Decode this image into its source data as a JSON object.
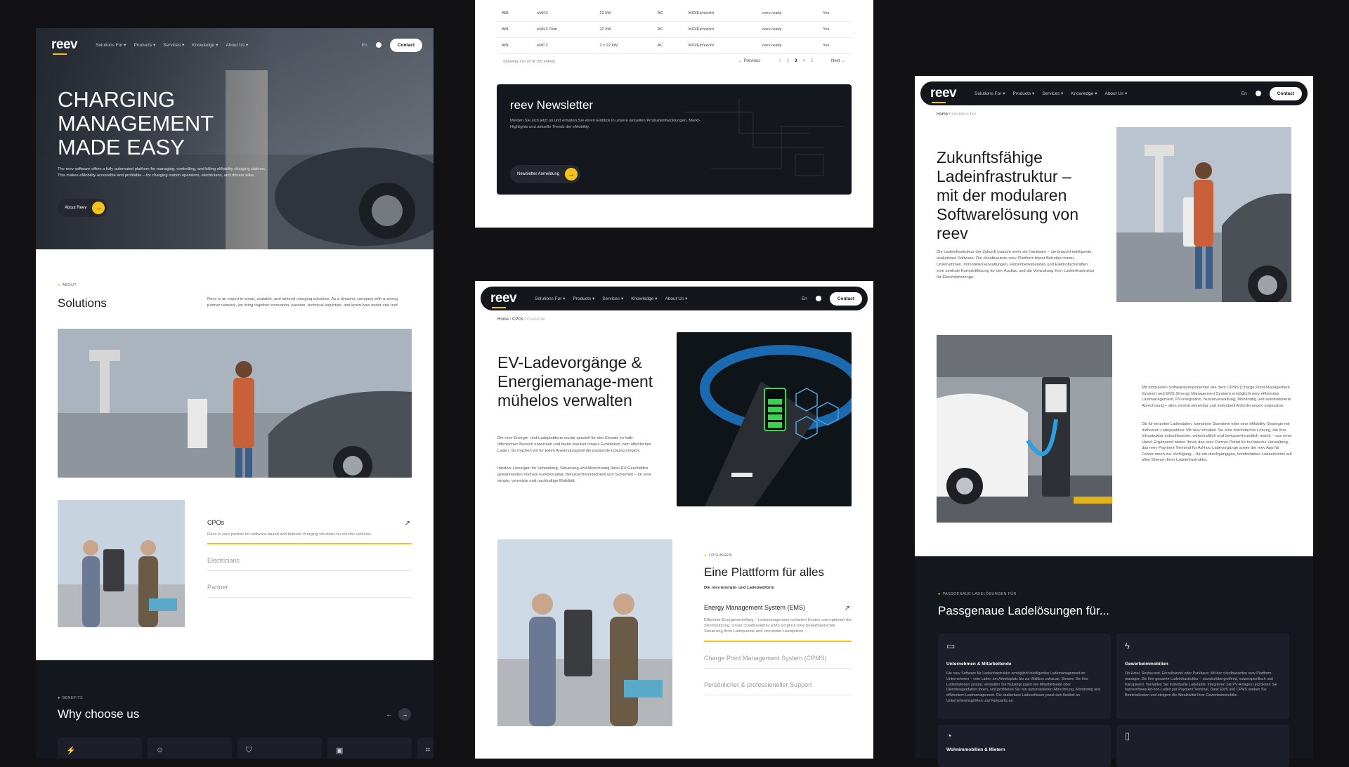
{
  "nav": {
    "logo": "reev",
    "menu": [
      "Solutions For",
      "Products",
      "Services",
      "Knowledge",
      "About Us"
    ],
    "lang": "En",
    "contact": "Contact"
  },
  "panel1": {
    "hero_title": "CHARGING MANAGEMENT MADE EASY",
    "hero_text": "The reev software offers a fully automated platform for managing, controlling, and billing eMobility charging stations. This makes eMobility accessible and profitable – for charging station operators, electricians, and drivers alike.",
    "hero_button": "About Reev",
    "about_eyebrow": "ABOUT",
    "solutions_title": "Solutions",
    "solutions_text": "Reev is an expert in smart, scalable, and tailored charging solutions. As a dynamic company with a strong partner network, we bring together innovation, passion, technical expertise, and know-how under one roof.",
    "tabs": [
      {
        "label": "CPOs",
        "desc": "Reev is your partner for software-based and tailored charging solutions for electric vehicles."
      },
      {
        "label": "Electricians",
        "desc": ""
      },
      {
        "label": "Partner",
        "desc": ""
      }
    ],
    "benefits_eyebrow": "BENEFITS",
    "why_title": "Why choose us"
  },
  "panel2": {
    "rows": [
      [
        "ABL",
        "eMH3",
        "22 kW",
        "AC",
        "MID/Eichrecht",
        "reev ready",
        "Yes"
      ],
      [
        "ABL",
        "eMH3 Twin",
        "22 kW",
        "AC",
        "MID/Eichrecht",
        "reev ready",
        "Yes"
      ],
      [
        "ABL",
        "eMC3",
        "2 x 22 kW",
        "AC",
        "MID/Eichrecht",
        "reev ready",
        "Yes"
      ]
    ],
    "showing": "Showing 1 to 10 of 150 entries",
    "previous": "Previous",
    "pages": [
      "1",
      "2",
      "3",
      "4",
      "5"
    ],
    "next": "Next",
    "newsletter_title": "reev Newsletter",
    "newsletter_text": "Melden Sie sich jetzt an und erhalten Sie einen Einblick in unsere aktuellen Produktentwicklungen, Markt-Highlights und aktuelle Trends der eMobility.",
    "newsletter_button": "Newsletter Anmeldung"
  },
  "panel3": {
    "crumbs": [
      "Home",
      "CPOs",
      "Customer"
    ],
    "title": "EV-Ladevorgänge & Energiemanage-ment mühelos verwalten",
    "text1": "Die reev Energie- und Ladeplattform wurde speziell für den Einsatz im halb-öffentlichen Bereich entwickelt und bietet darüber hinaus Funktionen zum öffentlichen Laden. So machen wir für jeden Anwendungsfall die passende Lösung mögich.",
    "text2": "Intuitive Lösungen für Verwaltung, Steuerung und Abrechnung Ihres EV-Geschäftes gewährleisten höchste Funktionalität, Benutzerfreundlichkeit und Sicherheit – für eine simple, vernetzte und nachhaltige Mobilität.",
    "eyebrow": "LÖSUNGEN",
    "platform_title": "Eine Plattform für alles",
    "platform_sub": "Die reev Energie- und Ladeplattform",
    "tabs": [
      {
        "label": "Energy Management System (EMS)",
        "desc": "Effiziente Energieverteilung – Lastmanagement reduziert Kosten und optimiert die Stromnutzung. Unser cloudbasiertes EMS sorgt für eine bedarfsgerechte Steuerung Ihrer Ladepunkte und vermeidet Lastspitzen."
      },
      {
        "label": "Charge Point Management System (CPMS)",
        "desc": ""
      },
      {
        "label": "Persönlicher & professioneller Support",
        "desc": ""
      }
    ]
  },
  "panel4": {
    "crumbs": [
      "Home",
      "Solutions For"
    ],
    "title": "Zukunftsfähige Ladeinfrastruktur – mit der modularen Softwarelösung von reev",
    "text": "Die Ladeinfrastruktur der Zukunft braucht mehr als Hardware – sie braucht intelligente, skalierbare Software. Die cloudbasierte reev Plattform bietet Betreiber:innen, Unternehmen, Immobilienverwaltungen, Flottenbetreibenden und Elektrofachkräften eine zentrale Komplettlösung für den Ausbau und die Verwaltung ihrer Ladeinfrastruktur für Elektrofahrzeuge.",
    "side_text1": "Mit modularen Softwarekomponenten wie dem CPMS (Charge Point Management System) und EMS (Energy Management System) ermöglicht reev effizientes Lastmanagement, PV-Integration, Nutzerverwaltung, Monitoring und automatisierte Abrechnung – alles zentral steuerbar und individuell Anforderungen anpassbar.",
    "side_text2": "Ob für einzelne Ladesäulen, komplexe Standorte oder eine eMobility-Strategie mit mehreren Ladepunkten: Mit reev erhalten Sie eine durchdachte Lösung, die Ihre Infrastruktur zukunftssicher, wirtschaftlich und benutzerfreundlich macht – aus einer Hand. Ergänzend bieten Ihnen das reev Partner Portal für technische Verwaltung, das reev Payment Terminal für Ad-hoc-Ladevorgänge sowie die reev App für Fahrer:innen zur Verfügung – für ein durchgängiges, komfortables Ladeerlebnis auf allen Ebenen Ihrer Ladeinfrastruktur.",
    "eyebrow": "PASSGENAUE LADELÖSUNGEN FÜR",
    "section_title": "Passgenaue Ladelösungen für...",
    "cards": [
      {
        "title": "Unternehmen & Mitarbeitende",
        "text": "Die reev Software für Ladeinfrastruktur ermöglicht intelligentes Lademanagement im Unternehmen – vom Laden am Arbeitsplatz bis zur Wallbox zuhause. Steuern Sie Ihre Ladestationen zentral, verwalten Sie Nutzergruppen wie Mitarbeitende oder Dienstwagenfahrer:innen, und profitieren Sie von automatisierter Abrechnung, Monitoring und effizientem Lastmanagement. Die skalierbare Ladesoftware passt sich flexibel an Unternehmensgrößen und Fuhrparks an."
      },
      {
        "title": "Gewerbeimmobilien",
        "text": "Ob Hotel, Restaurant, Einzelhandel oder Parkhaus: Mit der cloudbasierten reev Plattform managen Sie Ihre gesamte Ladeinfrastruktur – standortübergreifend, nutzerspezifisch und transparent. Verwalten Sie individuelle Ladetarife, integrieren Sie PV-Anlagen und bieten Sie barrierefreies Ad-hoc-Laden per Payment Terminal. Dank EMS und CPMS senken Sie Betriebskosten und steigern die Attraktivität Ihrer Gewerbeimmobilie."
      },
      {
        "title": "Wohnimmobilien & Mietern",
        "text": ""
      },
      {
        "title": "",
        "text": ""
      }
    ]
  }
}
